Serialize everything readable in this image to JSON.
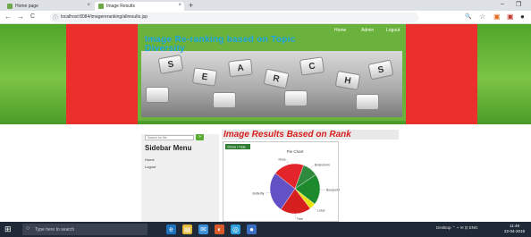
{
  "browser": {
    "tabs": [
      {
        "label": "Home page",
        "close": "×"
      },
      {
        "label": "Image Results",
        "close": "×"
      }
    ],
    "new_tab": "+",
    "window_controls": {
      "minimize": "–",
      "maximize": "❐"
    },
    "nav": {
      "back": "←",
      "forward": "→",
      "reload": "C"
    },
    "address": "localhost:8084/imagereranking/allresults.jsp",
    "address_info": "ⓘ",
    "toolbar_icons": {
      "zoom": "🔍",
      "bookmark": "☆",
      "extension": "▣",
      "profile": "●"
    }
  },
  "site": {
    "title": "Image Re-ranking based on Topic Diversity",
    "nav": [
      "Home",
      "Admin",
      "Logout"
    ],
    "banner_keys": [
      "S",
      "E",
      "A",
      "R",
      "C",
      "H",
      "S"
    ],
    "colors": {
      "green": "#6bb23c",
      "red": "#ea2f2c",
      "title_blue": "#1da3e0"
    }
  },
  "sidebar": {
    "search_placeholder": "Search for file",
    "search_button": "»",
    "title": "Sidebar Menu",
    "links": [
      "Home",
      "Logout"
    ]
  },
  "results": {
    "heading": "Image Results Based on Rank",
    "legend_button": "Show / hide"
  },
  "chart_data": {
    "type": "pie",
    "title": "Pie Chart",
    "slices": [
      {
        "label": "Brainstorm",
        "value": 10,
        "color": "#2e8b3e"
      },
      {
        "label": "Bouquet Flow",
        "value": 20,
        "color": "#1e8a2e"
      },
      {
        "label": "Lotus",
        "value": 4,
        "color": "#e8e20b"
      },
      {
        "label": "Tree",
        "value": 20,
        "color": "#d61f1f"
      },
      {
        "label": "Butterfly",
        "value": 26,
        "color": "#6252c6"
      },
      {
        "label": "Rose",
        "value": 20,
        "color": "#e2252a"
      }
    ]
  },
  "taskbar": {
    "start": "⊞",
    "search_placeholder": "Type here to search",
    "apps": [
      "e",
      "▤",
      "✉",
      "◐",
      "◎",
      "●"
    ],
    "tray": "Desktop  ⌃  ⌁  ✉  ⊡  ENG",
    "time": "11:49",
    "date": "22-04-2019"
  }
}
